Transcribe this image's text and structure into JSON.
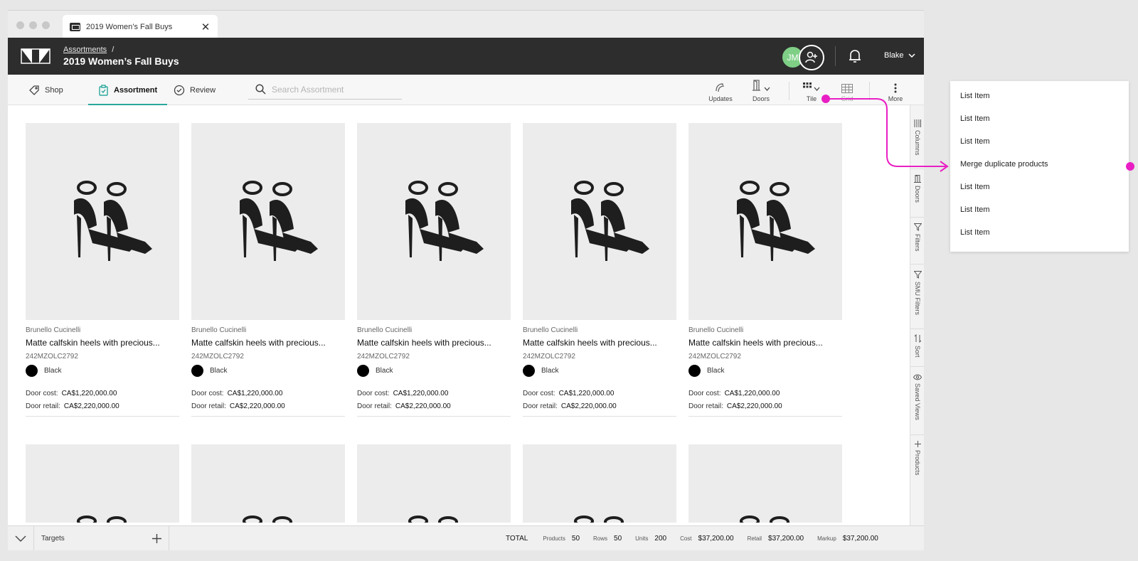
{
  "window": {
    "tab_title": "2019 Women’s Fall Buys"
  },
  "header": {
    "breadcrumb": "Assortments",
    "breadcrumb_sep": "/",
    "title": "2019 Women’s Fall Buys",
    "avatar_initials": "JM",
    "user_name": "Blake"
  },
  "toolbar": {
    "tabs": [
      {
        "label": "Shop",
        "icon": "tag-icon"
      },
      {
        "label": "Assortment",
        "icon": "clipboard-check-icon",
        "active": true
      },
      {
        "label": "Review",
        "icon": "check-circle-icon"
      }
    ],
    "search_placeholder": "Search Assortment",
    "tools": [
      {
        "label": "Updates",
        "icon": "updates-icon"
      },
      {
        "label": "Doors",
        "icon": "door-icon"
      },
      {
        "label": "Tile",
        "icon": "tile-view-icon"
      },
      {
        "label": "Grid",
        "icon": "grid-view-icon"
      },
      {
        "label": "More",
        "icon": "more-vertical-icon"
      }
    ]
  },
  "products": [
    {
      "brand": "Brunello Cucinelli",
      "name": "Matte calfskin heels with precious...",
      "sku": "242MZOLC2792",
      "color": "Black",
      "door_cost_label": "Door cost:",
      "door_cost": "CA$1,220,000.00",
      "door_retail_label": "Door retail:",
      "door_retail": "CA$2,220,000.00"
    },
    {
      "brand": "Brunello Cucinelli",
      "name": "Matte calfskin heels with precious...",
      "sku": "242MZOLC2792",
      "color": "Black",
      "door_cost_label": "Door cost:",
      "door_cost": "CA$1,220,000.00",
      "door_retail_label": "Door retail:",
      "door_retail": "CA$2,220,000.00"
    },
    {
      "brand": "Brunello Cucinelli",
      "name": "Matte calfskin heels with precious...",
      "sku": "242MZOLC2792",
      "color": "Black",
      "door_cost_label": "Door cost:",
      "door_cost": "CA$1,220,000.00",
      "door_retail_label": "Door retail:",
      "door_retail": "CA$2,220,000.00"
    },
    {
      "brand": "Brunello Cucinelli",
      "name": "Matte calfskin heels with precious...",
      "sku": "242MZOLC2792",
      "color": "Black",
      "door_cost_label": "Door cost:",
      "door_cost": "CA$1,220,000.00",
      "door_retail_label": "Door retail:",
      "door_retail": "CA$2,220,000.00"
    },
    {
      "brand": "Brunello Cucinelli",
      "name": "Matte calfskin heels with precious...",
      "sku": "242MZOLC2792",
      "color": "Black",
      "door_cost_label": "Door cost:",
      "door_cost": "CA$1,220,000.00",
      "door_retail_label": "Door retail:",
      "door_retail": "CA$2,220,000.00"
    }
  ],
  "siderail": [
    {
      "label": "Columns",
      "icon": "columns-icon"
    },
    {
      "label": "Doors",
      "icon": "door-icon"
    },
    {
      "label": "Filters",
      "icon": "filter-icon"
    },
    {
      "label": "SMU Filters",
      "icon": "filter-icon"
    },
    {
      "label": "Sort",
      "icon": "sort-icon"
    },
    {
      "label": "Saved Views",
      "icon": "eye-icon"
    },
    {
      "label": "Products",
      "icon": "plus-icon"
    }
  ],
  "footer": {
    "targets_label": "Targets",
    "total_label": "TOTAL",
    "stats": [
      {
        "label": "Products",
        "value": "50"
      },
      {
        "label": "Rows",
        "value": "50"
      },
      {
        "label": "Units",
        "value": "200"
      },
      {
        "label": "Cost",
        "value": "$37,200.00"
      },
      {
        "label": "Retail",
        "value": "$37,200.00"
      },
      {
        "label": "Markup",
        "value": "$37,200.00"
      }
    ]
  },
  "dropdown": {
    "items": [
      "List Item",
      "List Item",
      "List Item",
      "Merge duplicate products",
      "List Item",
      "List Item",
      "List Item"
    ]
  },
  "colors": {
    "accent": "#2aa79b",
    "header_bg": "#2d2d2d",
    "annotation": "#e91fc4",
    "avatar": "#7fcf86"
  }
}
